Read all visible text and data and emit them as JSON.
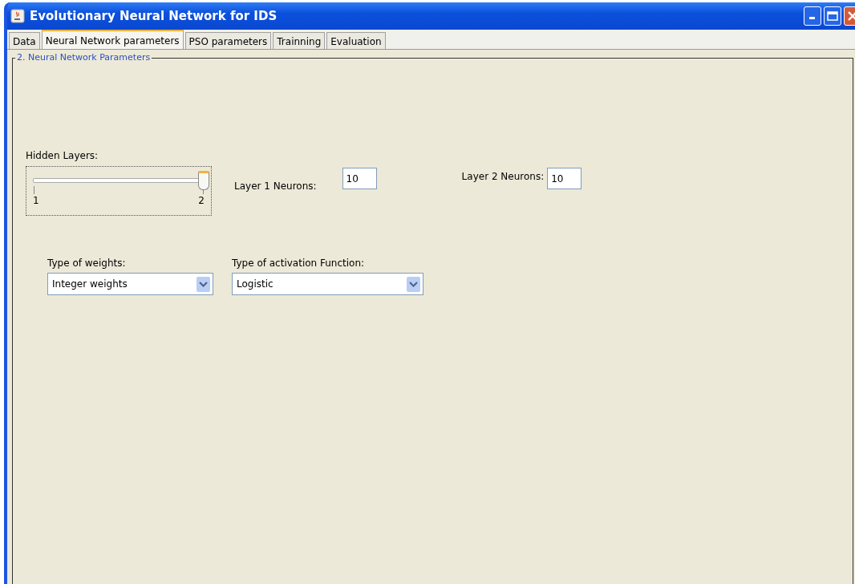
{
  "window": {
    "title": "Evolutionary Neural Network for IDS"
  },
  "tabs": [
    {
      "label": "Data",
      "selected": false
    },
    {
      "label": "Neural Network parameters",
      "selected": true
    },
    {
      "label": "PSO parameters",
      "selected": false
    },
    {
      "label": "Trainning",
      "selected": false
    },
    {
      "label": "Evaluation",
      "selected": false
    }
  ],
  "panel": {
    "title": "2. Neural Network Parameters",
    "hidden_layers": {
      "label": "Hidden Layers:",
      "level": 1,
      "min_label": "1",
      "max_label": "2"
    },
    "layer1": {
      "label": "Layer 1 Neurons:",
      "value": "10"
    },
    "layer2": {
      "label": "Layer 2 Neurons:",
      "value": "10"
    },
    "weights": {
      "label": "Type of weights:",
      "value": "Integer weights"
    },
    "activation": {
      "label": "Type of activation Function:",
      "value": "Logistic"
    }
  }
}
